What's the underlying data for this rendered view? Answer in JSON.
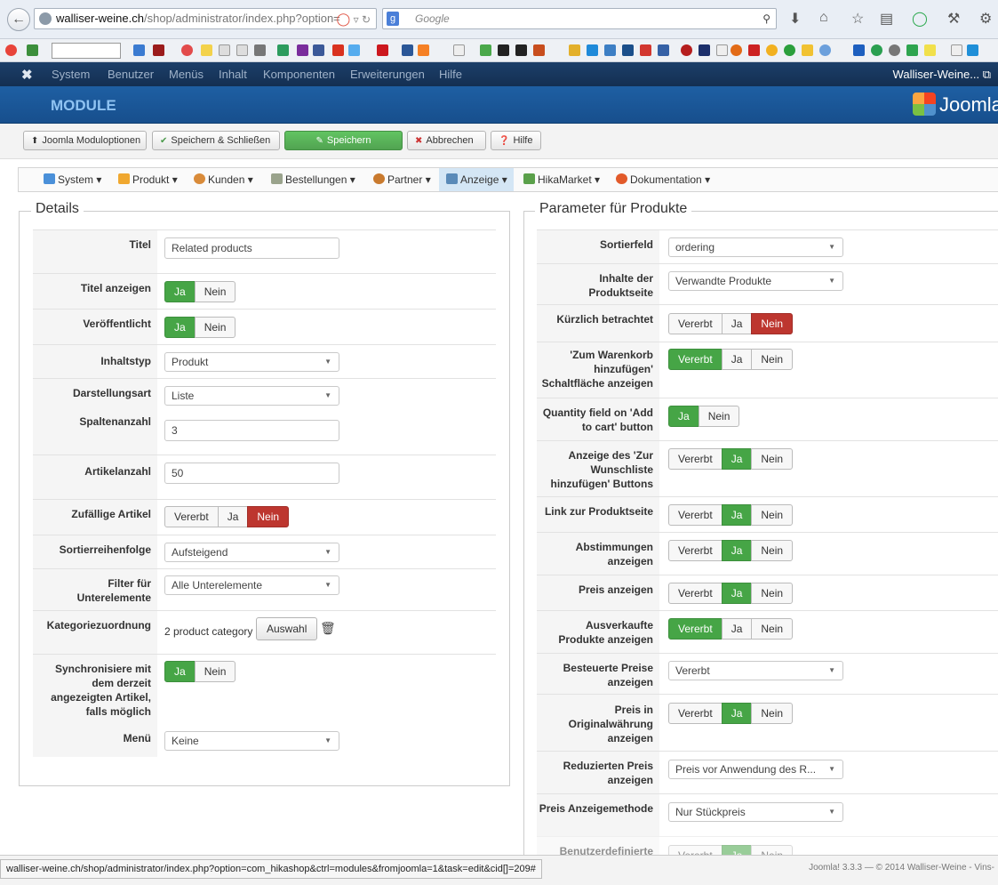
{
  "browser": {
    "url_host": "walliser-weine.ch",
    "url_path": "/shop/administrator/index.php?option=",
    "search_placeholder": "Google"
  },
  "topbar": {
    "menu": [
      "System",
      "Benutzer",
      "Menüs",
      "Inhalt",
      "Komponenten",
      "Erweiterungen",
      "Hilfe"
    ],
    "site_link": "Walliser-Weine..."
  },
  "header": {
    "title": "MODULE",
    "brand": "Joomla"
  },
  "toolbar": {
    "options": "Joomla Moduloptionen",
    "save_close": "Speichern & Schließen",
    "save": "Speichern",
    "cancel": "Abbrechen",
    "help": "Hilfe"
  },
  "hika_menu": [
    "System",
    "Produkt",
    "Kunden",
    "Bestellungen",
    "Partner",
    "Anzeige",
    "HikaMarket",
    "Dokumentation"
  ],
  "details": {
    "legend": "Details",
    "title_label": "Titel",
    "title_value": "Related products",
    "show_title_label": "Titel anzeigen",
    "published_label": "Veröffentlicht",
    "content_type_label": "Inhaltstyp",
    "content_type_value": "Produkt",
    "display_label": "Darstellungsart",
    "display_value": "Liste",
    "columns_label": "Spaltenanzahl",
    "columns_value": "3",
    "item_count_label": "Artikelanzahl",
    "item_count_value": "50",
    "random_label": "Zufällige Artikel",
    "order_label": "Sortierreihenfolge",
    "order_value": "Aufsteigend",
    "filter_label": "Filter für Unterelemente",
    "filter_value": "Alle Unterelemente",
    "category_label": "Kategoriezuordnung",
    "category_value": "2 product category",
    "choose_button": "Auswahl",
    "sync_label": "Synchronisiere mit dem derzeit angezeigten Artikel, falls möglich",
    "menu_label": "Menü",
    "menu_value": "Keine"
  },
  "params": {
    "legend": "Parameter für Produkte",
    "sort_field_label": "Sortierfeld",
    "sort_field_value": "ordering",
    "page_content_label": "Inhalte der Produktseite",
    "page_content_value": "Verwandte Produkte",
    "recent_label": "Kürzlich betrachtet",
    "cart_button_label": "'Zum Warenkorb hinzufügen' Schaltfläche anzeigen",
    "quantity_label": "Quantity field on 'Add to cart' button",
    "wishlist_label": "Anzeige des 'Zur Wunschliste hinzufügen' Buttons",
    "link_label": "Link zur Produktseite",
    "votes_label": "Abstimmungen anzeigen",
    "price_label": "Preis anzeigen",
    "soldout_label": "Ausverkaufte Produkte anzeigen",
    "taxed_label": "Besteuerte Preise anzeigen",
    "taxed_value": "Vererbt",
    "orig_currency_label": "Preis in Originalwährung anzeigen",
    "discount_label": "Reduzierten Preis anzeigen",
    "discount_value": "Preis vor Anwendung des R...",
    "price_method_label": "Preis Anzeigemethode",
    "price_method_value": "Nur Stückpreis",
    "custom_label": "Benutzerdefinierte"
  },
  "choices": {
    "inherit": "Vererbt",
    "yes": "Ja",
    "no": "Nein"
  },
  "status": {
    "url": "walliser-weine.ch/shop/administrator/index.php?option=com_hikashop&ctrl=modules&fromjoomla=1&task=edit&cid[]=209#",
    "footer": "Joomla! 3.3.3  —  © 2014 Walliser-Weine - Vins-"
  }
}
